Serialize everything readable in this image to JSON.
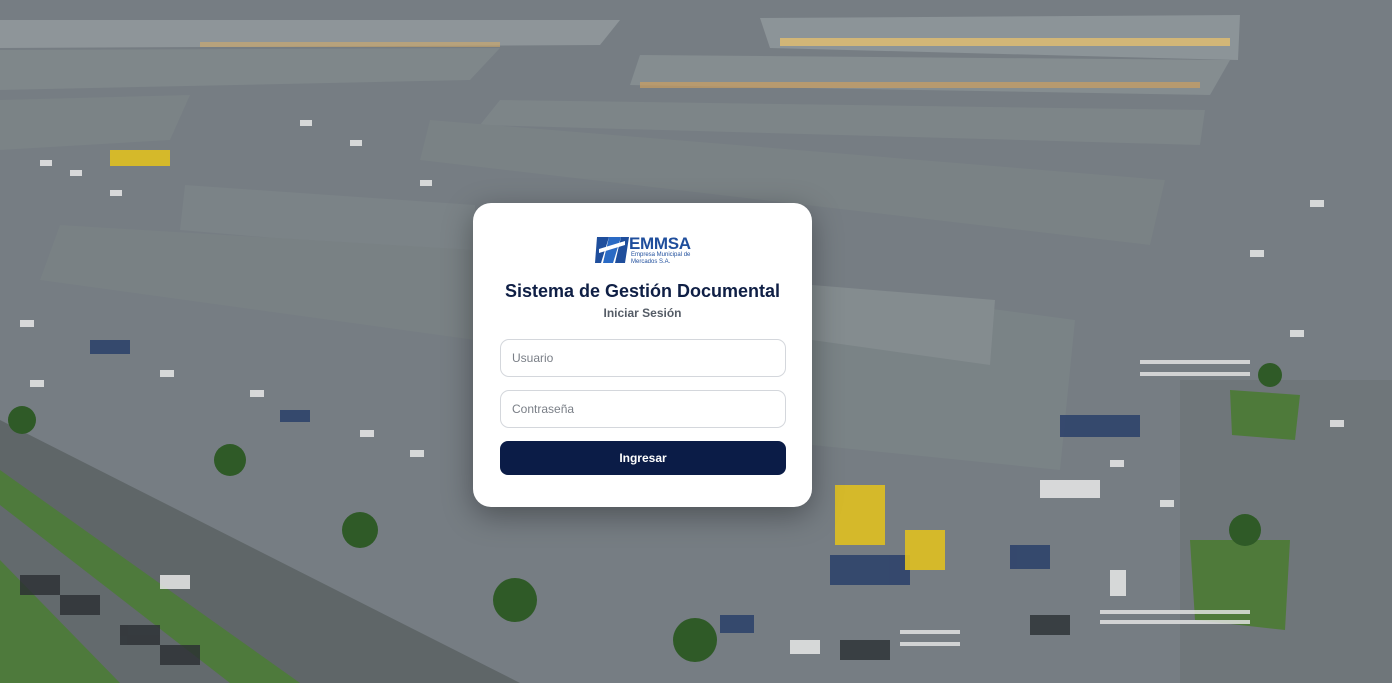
{
  "brand": {
    "name": "EMMSA",
    "subtitle": "Empresa Municipal de Mercados S.A.",
    "color": "#1f4e9c"
  },
  "login": {
    "title": "Sistema de Gestión Documental",
    "subtitle": "Iniciar Sesión",
    "username_placeholder": "Usuario",
    "password_placeholder": "Contraseña",
    "submit_label": "Ingresar",
    "button_color": "#0b1c47"
  },
  "background": {
    "description_icon": "market-aerial-photo"
  }
}
